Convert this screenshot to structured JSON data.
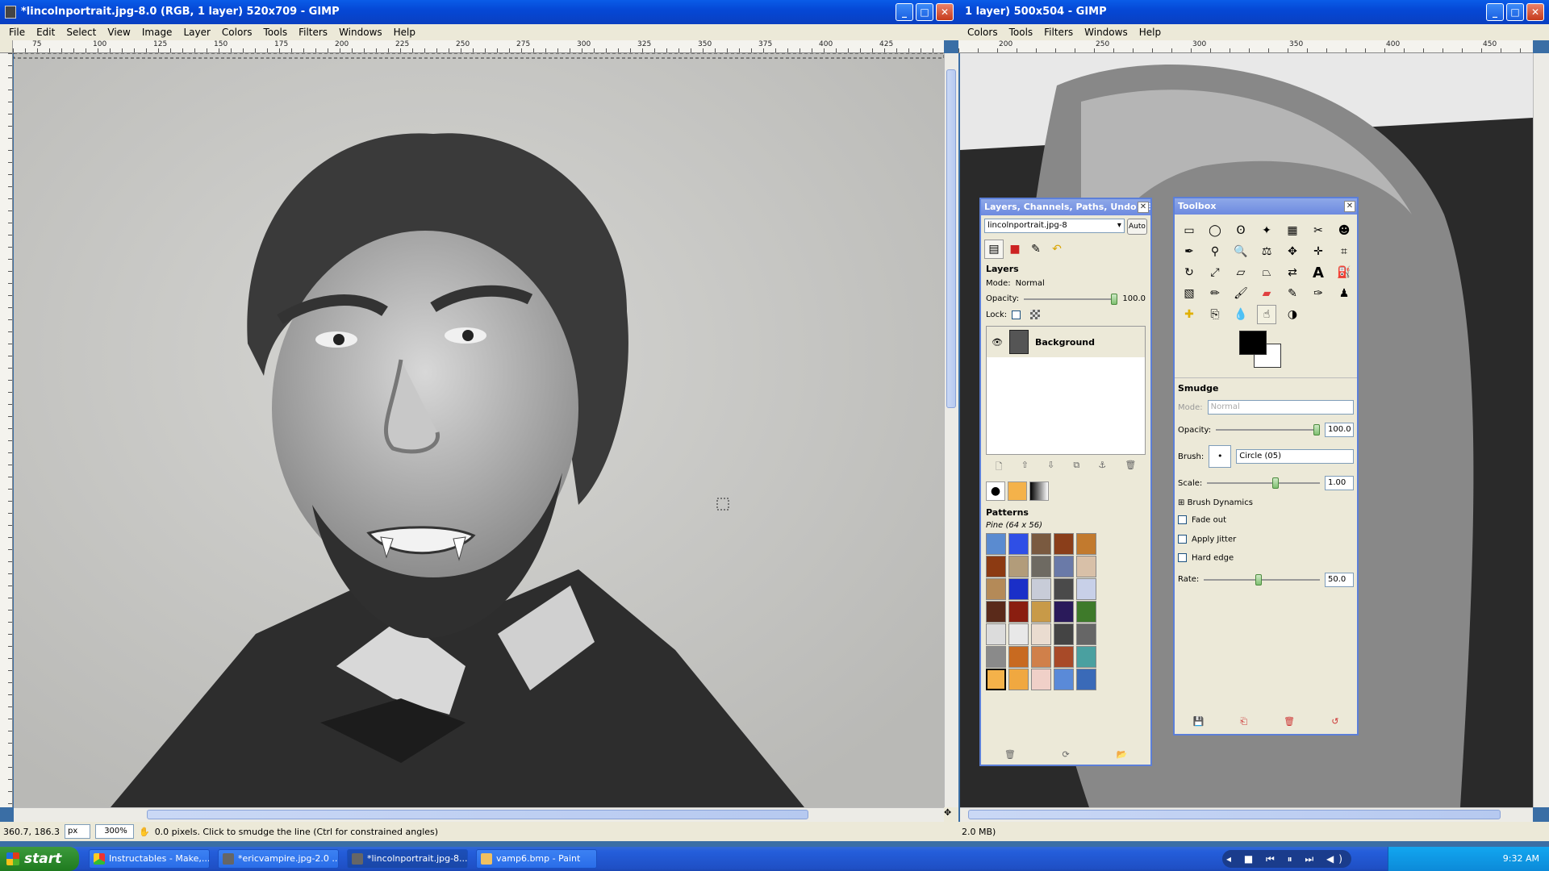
{
  "left_window": {
    "title": "*lincolnportrait.jpg-8.0 (RGB, 1 layer) 520x709 - GIMP",
    "menu": [
      "File",
      "Edit",
      "Select",
      "View",
      "Image",
      "Layer",
      "Colors",
      "Tools",
      "Filters",
      "Windows",
      "Help"
    ],
    "ruler_ticks": [
      "75",
      "100",
      "125",
      "150",
      "175",
      "200",
      "225",
      "250",
      "275",
      "300",
      "325",
      "350",
      "375",
      "400",
      "425"
    ],
    "status": {
      "coords": "360.7, 186.3",
      "unit": "px",
      "zoom": "300%",
      "message": "0.0 pixels.  Click to smudge the line (Ctrl for constrained angles)"
    }
  },
  "right_window": {
    "title": "1 layer) 500x504 - GIMP",
    "menu": [
      "Colors",
      "Tools",
      "Filters",
      "Windows",
      "Help"
    ],
    "ruler_ticks": [
      "200",
      "250",
      "300",
      "350",
      "400",
      "450"
    ],
    "status": "2.0 MB)"
  },
  "layers_dock": {
    "title": "Layers, Channels, Paths, Undo - B...",
    "image_select": "lincolnportrait.jpg-8",
    "auto_button": "Auto",
    "layers_label": "Layers",
    "mode_label": "Mode:",
    "mode_value": "Normal",
    "opacity_label": "Opacity:",
    "opacity_value": "100.0",
    "opacity_fraction": 1.0,
    "lock_label": "Lock:",
    "layer_name": "Background",
    "patterns_label": "Patterns",
    "pattern_selected": "Pine (64 x 56)"
  },
  "toolbox": {
    "title": "Toolbox",
    "tool_options_title": "Smudge",
    "mode_label": "Mode:",
    "mode_value": "Normal",
    "opacity_label": "Opacity:",
    "opacity_value": "100.0",
    "opacity_fraction": 1.0,
    "brush_label": "Brush:",
    "brush_value": "Circle (05)",
    "scale_label": "Scale:",
    "scale_value": "1.00",
    "brush_dynamics": "Brush Dynamics",
    "fade_out": "Fade out",
    "apply_jitter": "Apply Jitter",
    "hard_edge": "Hard edge",
    "rate_label": "Rate:",
    "rate_value": "50.0",
    "rate_fraction": 0.5,
    "fg_color": "#000000",
    "bg_color": "#ffffff"
  },
  "taskbar": {
    "start": "start",
    "tasks": [
      "Instructables - Make,...",
      "*ericvampire.jpg-2.0 ...",
      "*lincolnportrait.jpg-8....",
      "vamp6.bmp - Paint"
    ],
    "clock": "9:32 AM"
  }
}
